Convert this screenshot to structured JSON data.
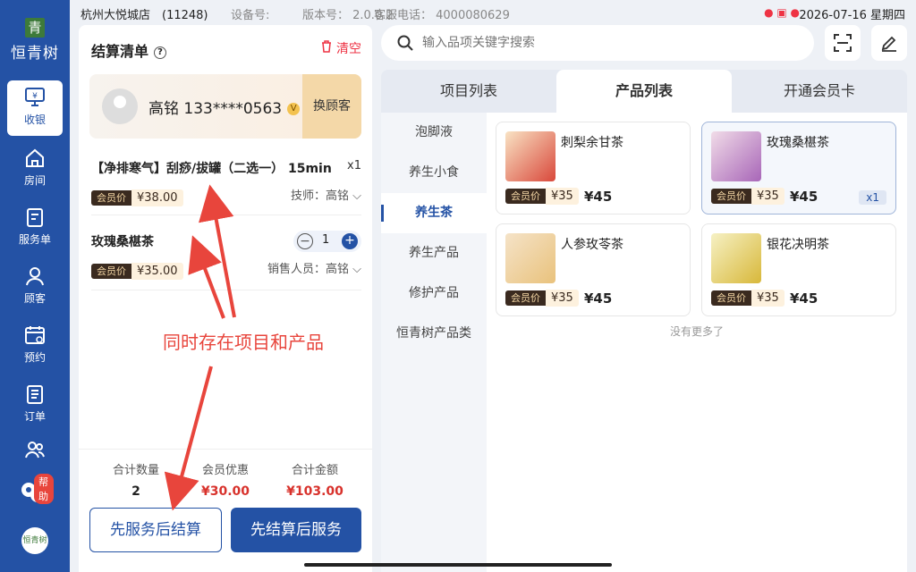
{
  "brand": {
    "logo_char": "青",
    "name": "恒青树",
    "small_logo": "恒青树"
  },
  "nav": {
    "items": [
      {
        "label": "收银",
        "icon": "cashier-icon"
      },
      {
        "label": "房间",
        "icon": "home-icon"
      },
      {
        "label": "服务单",
        "icon": "service-order-icon"
      },
      {
        "label": "顾客",
        "icon": "customer-icon"
      },
      {
        "label": "预约",
        "icon": "calendar-icon"
      },
      {
        "label": "订单",
        "icon": "order-icon"
      },
      {
        "label": "",
        "icon": "staff-icon"
      }
    ],
    "help_label": "帮助"
  },
  "status": {
    "store": "杭州大悦城店　(11248)",
    "device": "设备号:",
    "version": "版本号： 2.0.0.2",
    "phone": "客服电话： 4000080629",
    "datetime": "2026-07-16 星期四"
  },
  "checkout": {
    "title": "结算清单",
    "clear_label": "清空",
    "customer": {
      "name": "高铭 133****0563",
      "vip_mark": "V",
      "swap_label": "换顾客"
    },
    "items": [
      {
        "title": "【净排寒气】刮痧/拔罐（二选一） 15min",
        "qty": "x1",
        "member_label": "会员价",
        "price": "¥38.00",
        "staff": "技师：高铭"
      },
      {
        "title": "玫瑰桑椹茶",
        "qty": "1",
        "member_label": "会员价",
        "price": "¥35.00",
        "staff": "销售人员：高铭"
      }
    ],
    "summary": {
      "qty_label": "合计数量",
      "qty": "2",
      "discount_label": "会员优惠",
      "discount": "¥30.00",
      "total_label": "合计金额",
      "total": "¥103.00"
    },
    "btn_service_first": "先服务后结算",
    "btn_pay_first": "先结算后服务"
  },
  "annotation": "同时存在项目和产品",
  "search": {
    "placeholder": "输入品项关键字搜索"
  },
  "tabs": [
    "项目列表",
    "产品列表",
    "开通会员卡"
  ],
  "categories": [
    "泡脚液",
    "养生小食",
    "养生茶",
    "养生产品",
    "修护产品",
    "恒青树产品类"
  ],
  "products": [
    {
      "name": "刺梨余甘茶",
      "member_label": "会员价",
      "member_price": "¥35",
      "price": "¥45",
      "qty": ""
    },
    {
      "name": "玫瑰桑椹茶",
      "member_label": "会员价",
      "member_price": "¥35",
      "price": "¥45",
      "qty": "x1"
    },
    {
      "name": "人参玫苓茶",
      "member_label": "会员价",
      "member_price": "¥35",
      "price": "¥45",
      "qty": ""
    },
    {
      "name": "银花决明茶",
      "member_label": "会员价",
      "member_price": "¥35",
      "price": "¥45",
      "qty": ""
    }
  ],
  "no_more": "没有更多了",
  "colors": {
    "primary": "#2452a5",
    "accent_red": "#e8453c",
    "price_red": "#d8322c"
  }
}
